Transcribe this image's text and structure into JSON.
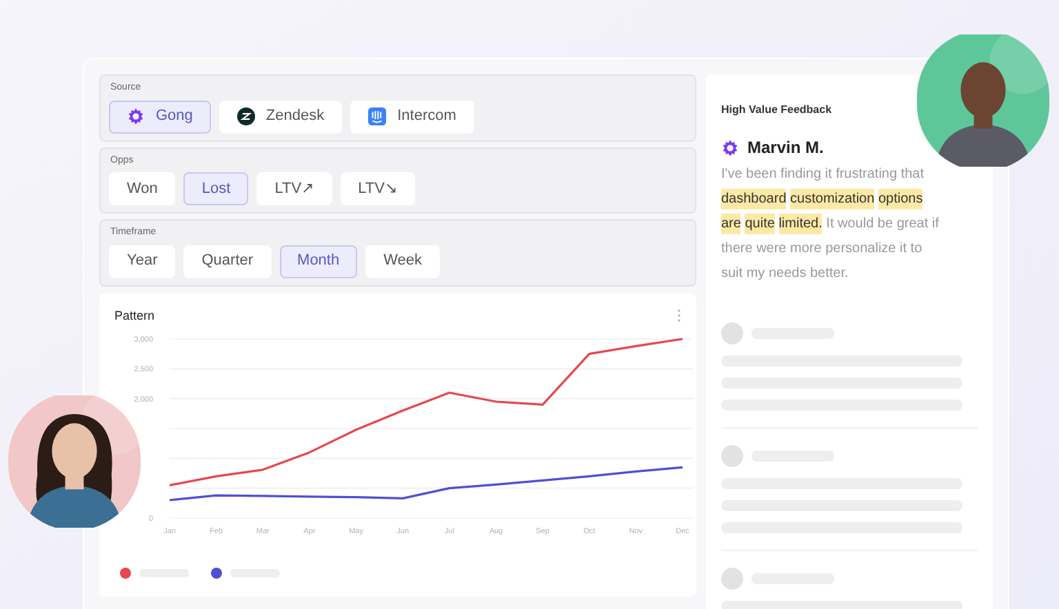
{
  "filters": [
    {
      "label": "Source",
      "options": [
        {
          "label": "Gong",
          "selected": true
        },
        {
          "label": "Zendesk",
          "selected": false
        },
        {
          "label": "Intercom",
          "selected": false
        }
      ]
    },
    {
      "label": "Opps",
      "options": [
        {
          "label": "Won",
          "selected": false
        },
        {
          "label": "Lost",
          "selected": true
        },
        {
          "label": "LTV↗",
          "selected": false
        },
        {
          "label": "LTV↘",
          "selected": false
        }
      ]
    },
    {
      "label": "Timeframe",
      "options": [
        {
          "label": "Year",
          "selected": false
        },
        {
          "label": "Quarter",
          "selected": false
        },
        {
          "label": "Month",
          "selected": true
        },
        {
          "label": "Week",
          "selected": false
        }
      ]
    }
  ],
  "chart": {
    "title": "Pattern",
    "chart_data": {
      "type": "line",
      "categories": [
        "Jan",
        "Feb",
        "Mar",
        "Apr",
        "May",
        "Jun",
        "Jul",
        "Aug",
        "Sep",
        "Oct",
        "Nov",
        "Dec"
      ],
      "series": [
        {
          "color": "#e5484d",
          "values": [
            550,
            700,
            810,
            1100,
            1480,
            1800,
            2100,
            1950,
            1900,
            2750,
            2880,
            3000
          ]
        },
        {
          "color": "#4f4fd6",
          "values": [
            300,
            380,
            370,
            360,
            350,
            330,
            500,
            560,
            630,
            700,
            780,
            850
          ]
        }
      ],
      "ylim": [
        0,
        3000
      ],
      "yticks": [
        {
          "value": 0,
          "label": "0"
        },
        {
          "value": 2000,
          "label": "2,000"
        },
        {
          "value": 2500,
          "label": "2,500"
        },
        {
          "value": 3000,
          "label": "3,000"
        }
      ]
    }
  },
  "feedback": {
    "title": "High Value Feedback",
    "author": "Marvin M.",
    "segments": [
      {
        "text": "I've been finding it frustrating that",
        "highlighted": false
      },
      {
        "text": "dashboard",
        "highlighted": true
      },
      {
        "text": "customization",
        "highlighted": true
      },
      {
        "text": "options",
        "highlighted": true
      },
      {
        "text": "are",
        "highlighted": true
      },
      {
        "text": "quite",
        "highlighted": true
      },
      {
        "text": "limited.",
        "highlighted": true
      },
      {
        "text": "It would be great if there were more personalize it to suit my needs better.",
        "highlighted": false
      }
    ]
  }
}
